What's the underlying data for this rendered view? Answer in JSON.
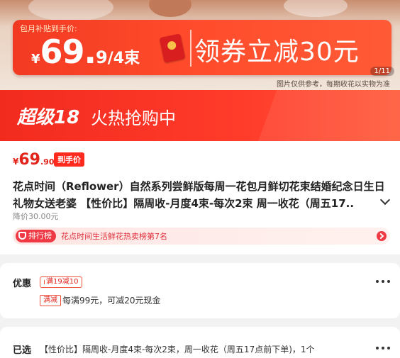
{
  "hero": {
    "subsidy_label": "包月补贴到手价:",
    "price_currency": "¥",
    "price_int": "69.",
    "price_frac": "9",
    "price_unit": "/4束",
    "coupon_text": "领券立减30元",
    "page_counter": "1/11",
    "disclaimer": "图片仅供参考，每期收花以实物为准"
  },
  "super_band": {
    "title": "超级18",
    "subtitle": "火热抢购中"
  },
  "product": {
    "price_currency": "¥",
    "price_int": "69",
    "price_dec": ".90",
    "deal_tag": "到手价",
    "title": "花点时间（Reflower）自然系列尝鲜版每周一花包月鲜切花束结婚纪念日生日礼物女送老婆 【性价比】隔周收-月度4束-每次2束 周一收花（周五17..",
    "original_price": "降价30.00元",
    "rank_badge": "排行榜",
    "rank_text": "花点时间生活鲜花热卖榜第7名"
  },
  "discount": {
    "label": "优惠",
    "coupon_tag": "满19减10",
    "full_tag": "满减",
    "full_desc": "每满99元，可减20元现金"
  },
  "selected": {
    "label": "已选",
    "desc": "【性价比】隔周收-月度4束-每次2束，周一收花（周五17点前下单)，1个"
  },
  "colors": {
    "accent": "#e2231a",
    "band": "#f22b1f"
  }
}
